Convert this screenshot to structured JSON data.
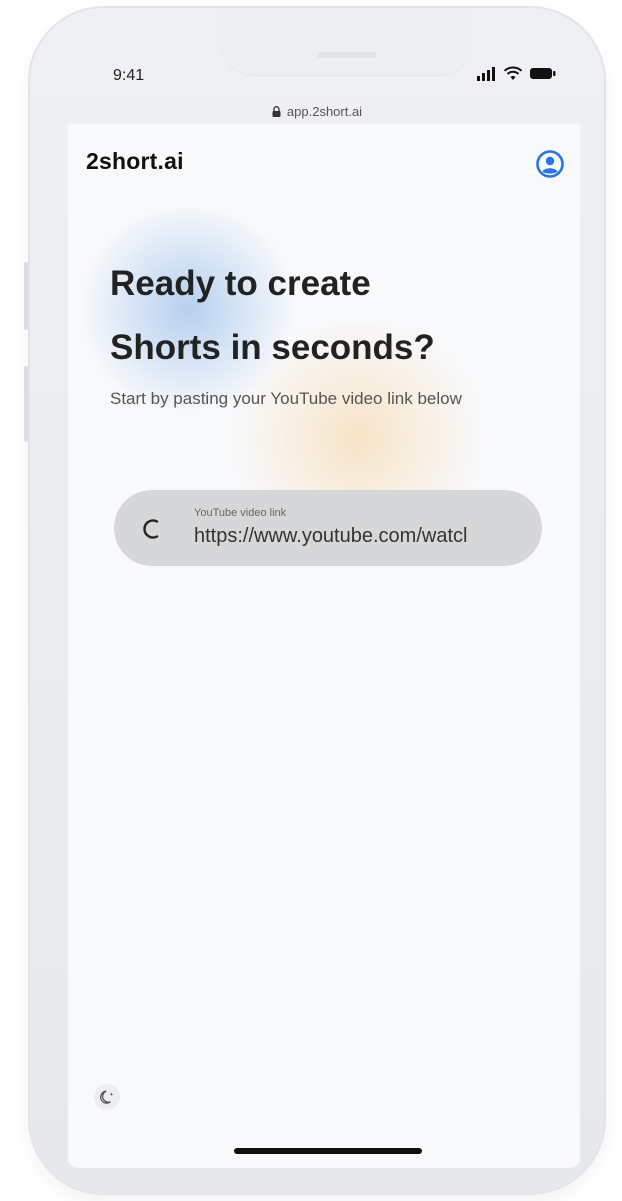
{
  "status_bar": {
    "time": "9:41"
  },
  "browser": {
    "url": "app.2short.ai"
  },
  "app": {
    "logo": "2short.ai",
    "headline_line1": "Ready to create",
    "headline_line2": "Shorts in seconds?",
    "subtitle": "Start by pasting your YouTube video link below",
    "video_input": {
      "label": "YouTube video link",
      "value": "https://www.youtube.com/watcl"
    }
  },
  "icons": {
    "account": "user-circle-icon",
    "loading": "spinner-icon",
    "theme": "moon-icon",
    "lock": "lock-icon"
  },
  "colors": {
    "accent": "#2b74e4",
    "input_background": "#d6d7d9",
    "screen_background": "#f8f9fb"
  }
}
